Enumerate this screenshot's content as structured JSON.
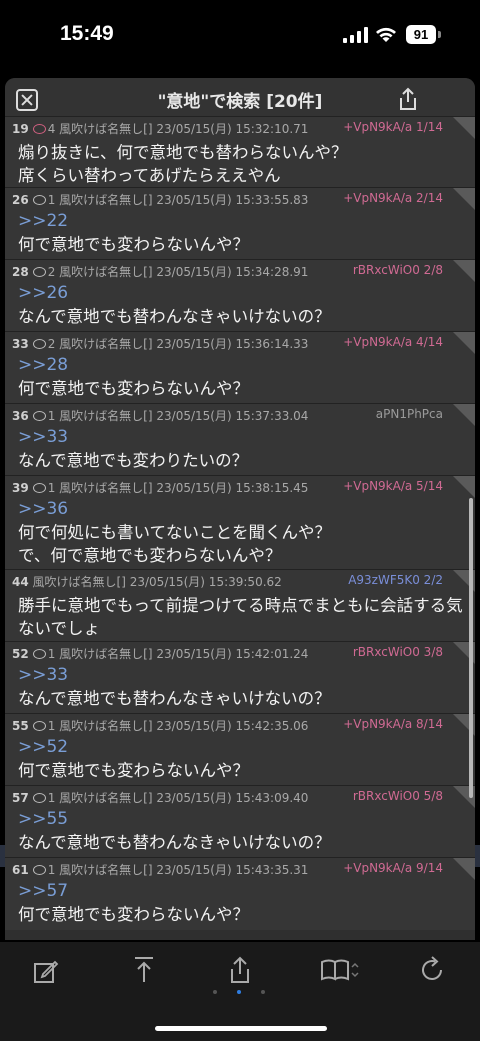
{
  "status_bar": {
    "time": "15:49",
    "battery": "91"
  },
  "header": {
    "title": "\"意地\"で検索 [20件]"
  },
  "posts": [
    {
      "num": "19",
      "replies": "4",
      "name": "風吹けば名無し[]",
      "date": "23/05/15(月) 15:32:10.71",
      "id": "+VpN9kA/a 1/14",
      "anchor": "",
      "lines": [
        "煽り抜きに、何で意地でも替わらないんや？",
        "席くらい替わってあげたらええやん"
      ]
    },
    {
      "num": "26",
      "replies": "1",
      "name": "風吹けば名無し[]",
      "date": "23/05/15(月) 15:33:55.83",
      "id": "+VpN9kA/a 2/14",
      "anchor": ">>22",
      "lines": [
        "何で意地でも変わらないんや？"
      ]
    },
    {
      "num": "28",
      "replies": "2",
      "name": "風吹けば名無し[]",
      "date": "23/05/15(月) 15:34:28.91",
      "id": "rBRxcWiO0 2/8",
      "anchor": ">>26",
      "lines": [
        "なんで意地でも替わんなきゃいけないの？"
      ]
    },
    {
      "num": "33",
      "replies": "2",
      "name": "風吹けば名無し[]",
      "date": "23/05/15(月) 15:36:14.33",
      "id": "+VpN9kA/a 4/14",
      "anchor": ">>28",
      "lines": [
        "何で意地でも変わらないんや？"
      ]
    },
    {
      "num": "36",
      "replies": "1",
      "name": "風吹けば名無し[]",
      "date": "23/05/15(月) 15:37:33.04",
      "id": "aPN1PhPca",
      "anchor": ">>33",
      "lines": [
        "なんで意地でも変わりたいの？"
      ]
    },
    {
      "num": "39",
      "replies": "1",
      "name": "風吹けば名無し[]",
      "date": "23/05/15(月) 15:38:15.45",
      "id": "+VpN9kA/a 5/14",
      "anchor": ">>36",
      "lines": [
        "何で何処にも書いてないことを聞くんや？",
        "で、何で意地でも変わらないんや？"
      ]
    },
    {
      "num": "44",
      "replies": "",
      "name": "風吹けば名無し[]",
      "date": "23/05/15(月) 15:39:50.62",
      "id": "A93zWF5K0 2/2",
      "anchor": "",
      "lines": [
        "勝手に意地でもって前提つけてる時点でまともに会話する気",
        "ないでしょ"
      ]
    },
    {
      "num": "52",
      "replies": "1",
      "name": "風吹けば名無し[]",
      "date": "23/05/15(月) 15:42:01.24",
      "id": "rBRxcWiO0 3/8",
      "anchor": ">>33",
      "lines": [
        "なんで意地でも替わんなきゃいけないの？"
      ]
    },
    {
      "num": "55",
      "replies": "1",
      "name": "風吹けば名無し[]",
      "date": "23/05/15(月) 15:42:35.06",
      "id": "+VpN9kA/a 8/14",
      "anchor": ">>52",
      "lines": [
        "何で意地でも変わらないんや？"
      ]
    },
    {
      "num": "57",
      "replies": "1",
      "name": "風吹けば名無し[]",
      "date": "23/05/15(月) 15:43:09.40",
      "id": "rBRxcWiO0 5/8",
      "anchor": ">>55",
      "lines": [
        "なんで意地でも替わんなきゃいけないの？"
      ]
    },
    {
      "num": "61",
      "replies": "1",
      "name": "風吹けば名無し[]",
      "date": "23/05/15(月) 15:43:35.31",
      "id": "+VpN9kA/a 9/14",
      "anchor": ">>57",
      "lines": [
        "何で意地でも変わらないんや？"
      ]
    }
  ],
  "toolbar": [
    "edit-icon",
    "scroll-top-icon",
    "share-icon",
    "bookmark-icon",
    "reload-icon"
  ]
}
